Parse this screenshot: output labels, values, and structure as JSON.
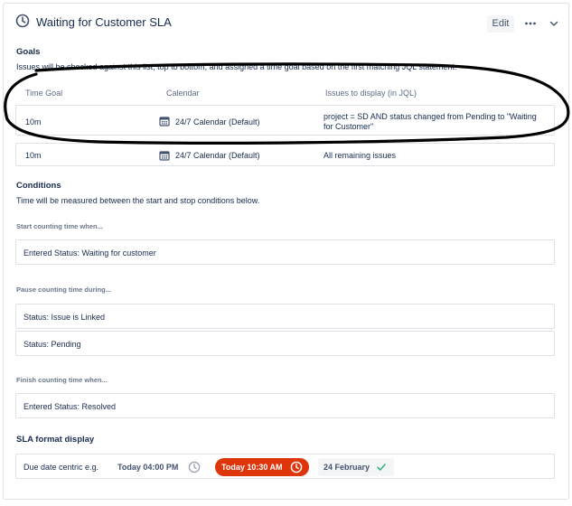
{
  "header": {
    "title": "Waiting for Customer SLA",
    "edit_label": "Edit",
    "more_icon": "more-icon",
    "chevron_icon": "chevron-down-icon"
  },
  "goals": {
    "title": "Goals",
    "description": "Issues will be checked against this list, top to bottom, and assigned a time goal based on the first matching JQL statement.",
    "columns": [
      "Time Goal",
      "Calendar",
      "Issues to display (in JQL)"
    ],
    "rows": [
      {
        "time": "10m",
        "calendar": "24/7 Calendar (Default)",
        "jql": "project = SD AND status changed from Pending to \"Waiting for Customer\""
      },
      {
        "time": "10m",
        "calendar": "24/7 Calendar (Default)",
        "jql": "All remaining issues"
      }
    ]
  },
  "conditions": {
    "title": "Conditions",
    "description": "Time will be measured between the start and stop conditions below.",
    "start_label": "Start counting time when...",
    "start_items": [
      "Entered Status: Waiting for customer"
    ],
    "pause_label": "Pause counting time during...",
    "pause_items": [
      "Status: Issue is Linked",
      "Status: Pending"
    ],
    "finish_label": "Finish counting time when...",
    "finish_items": [
      "Entered Status: Resolved"
    ]
  },
  "sla_format": {
    "title": "SLA format display",
    "label": "Due date centric e.g.",
    "today_normal": "Today 04:00 PM",
    "today_overdue": "Today 10:30 AM",
    "date_done": "24 February",
    "colors": {
      "overdue": "#de350b",
      "done_check": "#36b37e",
      "accent": "#172b4d"
    }
  }
}
